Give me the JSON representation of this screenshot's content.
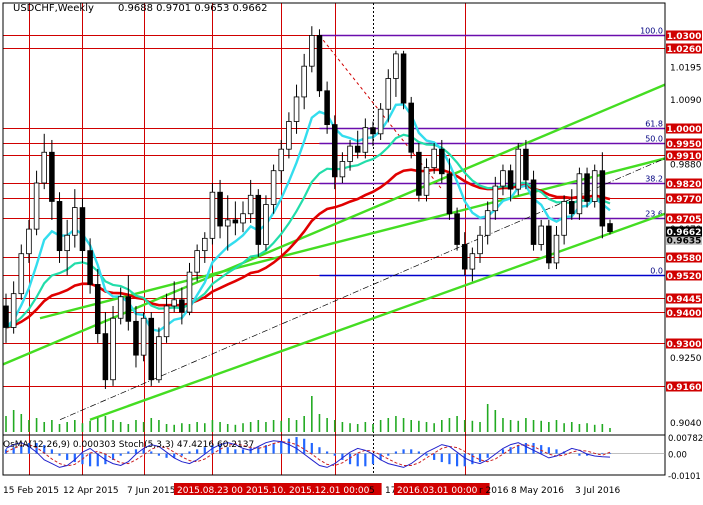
{
  "header": {
    "symbol": "USDCHF,Weekly",
    "ohlc": "0.9688 0.9701 0.9653 0.9662"
  },
  "indicator": {
    "label": "OsMA(12,26,9) 0.000303 Stoch(5,3,3) 47.4216 60.2137",
    "ticks": [
      "0.00782",
      "0.00",
      "-0.0101"
    ]
  },
  "colors": {
    "background": "#ffffff",
    "frame": "#000000",
    "bull_candle": "#ffffff",
    "bear_candle": "#000000",
    "level_line": "#d00000",
    "level_label_bg": "#d00000",
    "fib_line": "#6a0dad",
    "fib_blue_line": "#0000cc",
    "trend_channel": "#44dd22",
    "ema_red": "#e00000",
    "ema_cyan": "#33ddee",
    "ema_teal": "#22ddaa",
    "volume": "#22aa22",
    "osma_bars": "#2266ff",
    "stoch_main": "#2222cc",
    "stoch_signal": "#cc2222",
    "current_price_bg": "#000000",
    "prev_price_bg": "#c0c0c0"
  },
  "chart_data": {
    "type": "candlestick",
    "title": "USDCHF,Weekly",
    "price_range": [
      0.901,
      1.036
    ],
    "price_ticks": [
      "1.0195",
      "1.0090",
      "0.9880",
      "0.9670",
      "0.9250",
      "0.9040"
    ],
    "x_labels": [
      "15 Feb 2015",
      "12 Apr 2015",
      "7 Jun 2015",
      "2015.08.23 00:00",
      "2015.10.18 00:00",
      "2015.12.01 00:00",
      "5",
      "17",
      "2016.03.01 00:00",
      "r 2016",
      "8 May 2016",
      "3 Jul 2016"
    ],
    "highlighted_x_labels": [
      "2015.08.23 00:00",
      "2015.10.18 00:00",
      "2015.12.01 00:00",
      "2016.03.01 00:00"
    ],
    "levels": [
      {
        "label": "1.0300",
        "value": 1.03
      },
      {
        "label": "1.0260",
        "value": 1.026
      },
      {
        "label": "1.0000",
        "value": 1.0
      },
      {
        "label": "0.9950",
        "value": 0.995
      },
      {
        "label": "0.9910",
        "value": 0.991
      },
      {
        "label": "0.9820",
        "value": 0.982
      },
      {
        "label": "0.9770",
        "value": 0.977
      },
      {
        "label": "0.9705",
        "value": 0.9705
      },
      {
        "label": "0.9580",
        "value": 0.958
      },
      {
        "label": "0.9520",
        "value": 0.952
      },
      {
        "label": "0.9445",
        "value": 0.9445
      },
      {
        "label": "0.9400",
        "value": 0.94
      },
      {
        "label": "0.9300",
        "value": 0.93
      },
      {
        "label": "0.9160",
        "value": 0.916
      }
    ],
    "fib_levels": [
      {
        "label": "100.0",
        "value": 1.03
      },
      {
        "label": "61.8",
        "value": 1.0
      },
      {
        "label": "50.0",
        "value": 0.995
      },
      {
        "label": "38.2",
        "value": 0.982
      },
      {
        "label": "23.6",
        "value": 0.9705
      },
      {
        "label": "0.0",
        "value": 0.952
      }
    ],
    "current_price": {
      "label": "0.9662",
      "value": 0.9662
    },
    "prev_price": {
      "label": "0.9635",
      "value": 0.9635
    },
    "candles": [
      [
        0.942,
        0.946,
        0.93,
        0.935
      ],
      [
        0.935,
        0.95,
        0.933,
        0.946
      ],
      [
        0.946,
        0.962,
        0.944,
        0.959
      ],
      [
        0.959,
        0.97,
        0.956,
        0.967
      ],
      [
        0.967,
        0.986,
        0.965,
        0.982
      ],
      [
        0.982,
        0.998,
        0.98,
        0.992
      ],
      [
        0.992,
        0.996,
        0.97,
        0.976
      ],
      [
        0.976,
        0.979,
        0.956,
        0.96
      ],
      [
        0.96,
        0.97,
        0.952,
        0.965
      ],
      [
        0.965,
        0.98,
        0.961,
        0.974
      ],
      [
        0.974,
        0.977,
        0.956,
        0.96
      ],
      [
        0.96,
        0.964,
        0.946,
        0.949
      ],
      [
        0.949,
        0.954,
        0.93,
        0.933
      ],
      [
        0.933,
        0.94,
        0.915,
        0.918
      ],
      [
        0.918,
        0.942,
        0.916,
        0.938
      ],
      [
        0.938,
        0.948,
        0.936,
        0.945
      ],
      [
        0.945,
        0.952,
        0.934,
        0.937
      ],
      [
        0.937,
        0.942,
        0.922,
        0.926
      ],
      [
        0.926,
        0.94,
        0.924,
        0.938
      ],
      [
        0.938,
        0.94,
        0.916,
        0.918
      ],
      [
        0.918,
        0.935,
        0.917,
        0.932
      ],
      [
        0.932,
        0.946,
        0.93,
        0.942
      ],
      [
        0.942,
        0.95,
        0.94,
        0.944
      ],
      [
        0.944,
        0.948,
        0.936,
        0.94
      ],
      [
        0.94,
        0.956,
        0.939,
        0.953
      ],
      [
        0.953,
        0.962,
        0.95,
        0.96
      ],
      [
        0.96,
        0.966,
        0.956,
        0.964
      ],
      [
        0.964,
        0.982,
        0.962,
        0.979
      ],
      [
        0.979,
        0.983,
        0.964,
        0.968
      ],
      [
        0.968,
        0.978,
        0.96,
        0.97
      ],
      [
        0.97,
        0.976,
        0.965,
        0.969
      ],
      [
        0.969,
        0.976,
        0.966,
        0.972
      ],
      [
        0.972,
        0.983,
        0.969,
        0.978
      ],
      [
        0.978,
        0.98,
        0.958,
        0.962
      ],
      [
        0.962,
        0.978,
        0.96,
        0.975
      ],
      [
        0.975,
        0.988,
        0.972,
        0.986
      ],
      [
        0.986,
        0.996,
        0.982,
        0.993
      ],
      [
        0.993,
        1.005,
        0.99,
        1.002
      ],
      [
        1.002,
        1.014,
        0.998,
        1.01
      ],
      [
        1.01,
        1.024,
        1.006,
        1.02
      ],
      [
        1.02,
        1.033,
        1.018,
        1.03
      ],
      [
        1.03,
        1.032,
        1.01,
        1.012
      ],
      [
        1.012,
        1.015,
        0.998,
        1.001
      ],
      [
        1.001,
        1.004,
        0.98,
        0.984
      ],
      [
        0.984,
        0.992,
        0.982,
        0.989
      ],
      [
        0.989,
        0.996,
        0.986,
        0.994
      ],
      [
        0.994,
        0.999,
        0.99,
        0.992
      ],
      [
        0.992,
        1.003,
        0.99,
        1.0
      ],
      [
        1.0,
        1.002,
        0.994,
        0.998
      ],
      [
        0.998,
        1.008,
        0.996,
        1.006
      ],
      [
        1.006,
        1.019,
        1.002,
        1.016
      ],
      [
        1.016,
        1.025,
        1.01,
        1.024
      ],
      [
        1.024,
        1.025,
        1.006,
        1.008
      ],
      [
        1.008,
        1.01,
        0.99,
        0.992
      ],
      [
        0.992,
        0.995,
        0.976,
        0.978
      ],
      [
        0.978,
        0.99,
        0.976,
        0.987
      ],
      [
        0.987,
        0.995,
        0.985,
        0.993
      ],
      [
        0.993,
        0.996,
        0.982,
        0.985
      ],
      [
        0.985,
        0.99,
        0.97,
        0.972
      ],
      [
        0.972,
        0.974,
        0.96,
        0.962
      ],
      [
        0.962,
        0.966,
        0.952,
        0.954
      ],
      [
        0.954,
        0.961,
        0.95,
        0.959
      ],
      [
        0.959,
        0.968,
        0.956,
        0.965
      ],
      [
        0.965,
        0.976,
        0.962,
        0.973
      ],
      [
        0.973,
        0.984,
        0.97,
        0.981
      ],
      [
        0.981,
        0.988,
        0.978,
        0.986
      ],
      [
        0.986,
        0.988,
        0.976,
        0.98
      ],
      [
        0.98,
        0.995,
        0.978,
        0.993
      ],
      [
        0.993,
        0.996,
        0.98,
        0.983
      ],
      [
        0.983,
        0.986,
        0.96,
        0.962
      ],
      [
        0.962,
        0.97,
        0.96,
        0.968
      ],
      [
        0.968,
        0.97,
        0.954,
        0.956
      ],
      [
        0.956,
        0.968,
        0.954,
        0.965
      ],
      [
        0.965,
        0.978,
        0.962,
        0.976
      ],
      [
        0.976,
        0.98,
        0.97,
        0.972
      ],
      [
        0.972,
        0.987,
        0.97,
        0.985
      ],
      [
        0.985,
        0.987,
        0.974,
        0.976
      ],
      [
        0.976,
        0.988,
        0.974,
        0.986
      ],
      [
        0.986,
        0.992,
        0.964,
        0.968
      ],
      [
        0.9688,
        0.9701,
        0.9653,
        0.9662
      ]
    ],
    "volume": [
      0.4,
      0.55,
      0.45,
      0.3,
      0.35,
      0.25,
      0.3,
      0.2,
      0.25,
      0.3,
      0.22,
      0.28,
      0.35,
      0.4,
      0.3,
      0.25,
      0.2,
      0.3,
      0.25,
      0.35,
      0.3,
      0.2,
      0.18,
      0.22,
      0.2,
      0.25,
      0.22,
      0.3,
      0.25,
      0.2,
      0.18,
      0.22,
      0.25,
      0.3,
      0.25,
      0.3,
      0.28,
      0.35,
      0.3,
      0.4,
      0.9,
      0.45,
      0.35,
      0.3,
      0.25,
      0.22,
      0.2,
      0.25,
      0.2,
      0.3,
      0.35,
      0.4,
      0.35,
      0.3,
      0.28,
      0.25,
      0.22,
      0.3,
      0.35,
      0.4,
      0.3,
      0.28,
      0.25,
      0.7,
      0.55,
      0.35,
      0.3,
      0.28,
      0.35,
      0.3,
      0.28,
      0.25,
      0.3,
      0.22,
      0.25,
      0.2,
      0.22,
      0.18,
      0.2,
      0.1
    ],
    "osma": [
      0.002,
      0.003,
      0.004,
      0.005,
      0.005,
      0.004,
      0.002,
      -0.001,
      -0.003,
      -0.004,
      -0.005,
      -0.006,
      -0.006,
      -0.005,
      -0.003,
      -0.001,
      0.001,
      0.002,
      0.002,
      0.001,
      -0.001,
      -0.002,
      -0.002,
      -0.001,
      0.001,
      0.002,
      0.003,
      0.004,
      0.004,
      0.003,
      0.002,
      0.002,
      0.003,
      0.003,
      0.004,
      0.005,
      0.006,
      0.007,
      0.0078,
      0.007,
      0.005,
      0.003,
      0.001,
      -0.001,
      -0.003,
      -0.005,
      -0.006,
      -0.006,
      -0.005,
      -0.003,
      -0.001,
      0.001,
      0.002,
      0.002,
      0.001,
      -0.001,
      -0.003,
      -0.004,
      -0.005,
      -0.006,
      -0.006,
      -0.005,
      -0.004,
      -0.002,
      0.0,
      0.002,
      0.003,
      0.004,
      0.005,
      0.005,
      0.004,
      0.003,
      0.002,
      0.001,
      0.0,
      -0.001,
      -0.001,
      0.0,
      0.0003,
      0.0003
    ],
    "stoch_main": [
      70,
      80,
      85,
      75,
      60,
      40,
      30,
      20,
      25,
      40,
      60,
      70,
      55,
      40,
      30,
      25,
      35,
      55,
      70,
      80,
      75,
      60,
      45,
      35,
      30,
      40,
      55,
      70,
      80,
      85,
      80,
      70,
      65,
      75,
      85,
      90,
      88,
      80,
      70,
      55,
      40,
      25,
      20,
      30,
      45,
      60,
      70,
      65,
      55,
      40,
      30,
      25,
      20,
      30,
      45,
      60,
      70,
      80,
      75,
      60,
      45,
      35,
      30,
      40,
      55,
      70,
      80,
      85,
      75,
      65,
      55,
      45,
      50,
      60,
      70,
      65,
      55,
      50,
      48,
      47
    ],
    "stoch_signal": [
      60,
      70,
      78,
      80,
      72,
      58,
      42,
      30,
      24,
      28,
      42,
      58,
      62,
      55,
      42,
      32,
      30,
      40,
      53,
      68,
      75,
      72,
      60,
      48,
      38,
      35,
      42,
      55,
      68,
      78,
      82,
      78,
      72,
      70,
      75,
      83,
      88,
      86,
      80,
      68,
      55,
      40,
      28,
      25,
      32,
      45,
      58,
      65,
      63,
      53,
      42,
      32,
      25,
      25,
      32,
      45,
      58,
      70,
      75,
      72,
      62,
      50,
      40,
      35,
      42,
      55,
      68,
      78,
      80,
      75,
      65,
      55,
      50,
      52,
      60,
      65,
      63,
      57,
      52,
      60
    ]
  }
}
